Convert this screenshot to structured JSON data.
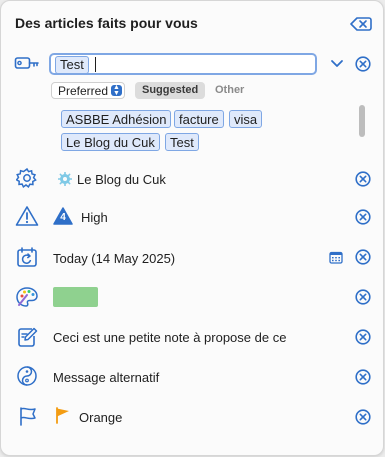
{
  "header": {
    "title": "Des articles faits pour vous"
  },
  "tags_field": {
    "current_tag": "Test"
  },
  "filter": {
    "select_value": "Preferred",
    "segments": [
      "Suggested",
      "Other"
    ]
  },
  "suggested_tags": [
    "ASBBE Adhésion",
    "facture",
    "visa",
    "Le Blog du Cuk",
    "Test"
  ],
  "rows": {
    "project": {
      "label": "Le Blog du Cuk"
    },
    "priority": {
      "label": "High",
      "badge": "4"
    },
    "date": {
      "label": "Today (14 May 2025)"
    },
    "note": {
      "label": "Ceci est une petite note à propose de ce"
    },
    "alt": {
      "label": "Message alternatif"
    },
    "flag": {
      "label": "Orange"
    }
  },
  "colors": {
    "accent": "#2f6fc8",
    "swatch": "#8fd18f",
    "flag": "#f39c12",
    "priority": "#2f6fc8"
  }
}
